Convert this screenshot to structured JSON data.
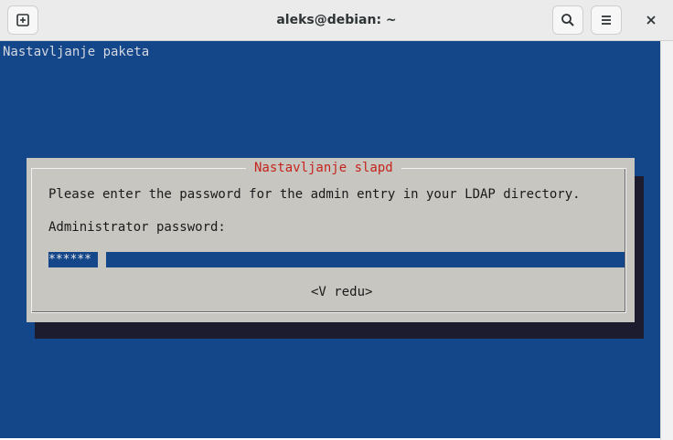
{
  "window": {
    "title": "aleks@debian: ~",
    "new_tab_icon": "new-tab-icon",
    "search_icon": "search-icon",
    "menu_icon": "hamburger-menu-icon",
    "close_icon": "close-icon"
  },
  "terminal": {
    "background": "#14468a",
    "header_text": "Nastavljanje paketa"
  },
  "dialog": {
    "title": "Nastavljanje slapd",
    "prompt": "Please enter the password for the admin entry in your LDAP directory.",
    "field_label": "Administrator password:",
    "password_value": "******",
    "ok_button_label": "<V redu>",
    "title_color": "#c4241c",
    "background": "#c8c6c1"
  }
}
